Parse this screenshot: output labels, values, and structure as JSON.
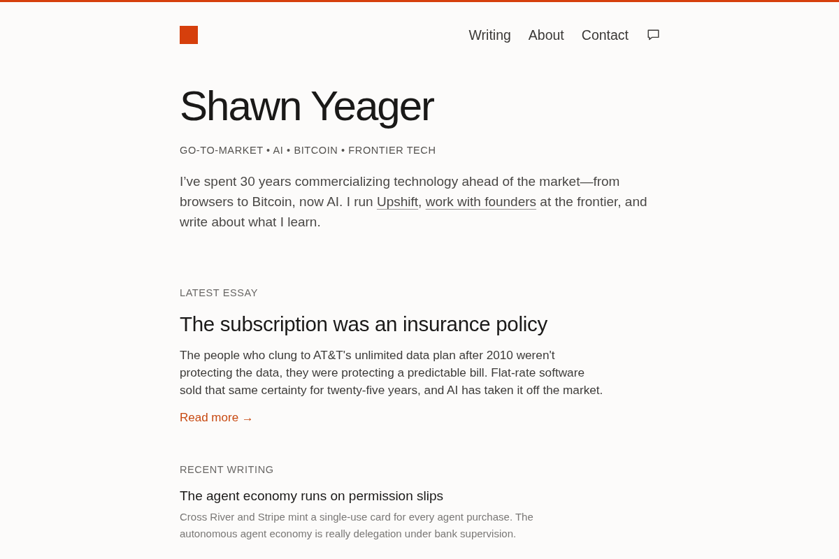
{
  "header": {
    "nav": [
      "Writing",
      "About",
      "Contact"
    ]
  },
  "hero": {
    "name": "Shawn Yeager",
    "tagline": "GO-TO-MARKET • AI • BITCOIN • FRONTIER TECH",
    "bio": [
      {
        "kind": "text",
        "text": "I’ve spent 30 years commercializing technology ahead of the market—from browsers to Bitcoin, now AI. I run "
      },
      {
        "kind": "link",
        "text": "Upshift"
      },
      {
        "kind": "text",
        "text": ", "
      },
      {
        "kind": "link",
        "text": "work with founders"
      },
      {
        "kind": "text",
        "text": " at the frontier, and write about what I learn."
      }
    ]
  },
  "latest_essay": {
    "label": "LATEST ESSAY",
    "title": "The subscription was an insurance policy",
    "summary": "The people who clung to AT&T's unlimited data plan after 2010 weren't protecting the data, they were protecting a predictable bill. Flat-rate software sold that same certainty for twenty-five years, and AI has taken it off the market.",
    "link": "Read more →"
  },
  "recent_writing": {
    "label": "RECENT WRITING",
    "items": [
      {
        "title": "The agent economy runs on permission slips",
        "summary": "Cross River and Stripe mint a single-use card for every agent purchase. The autonomous agent economy is really delegation under bank supervision."
      }
    ]
  }
}
